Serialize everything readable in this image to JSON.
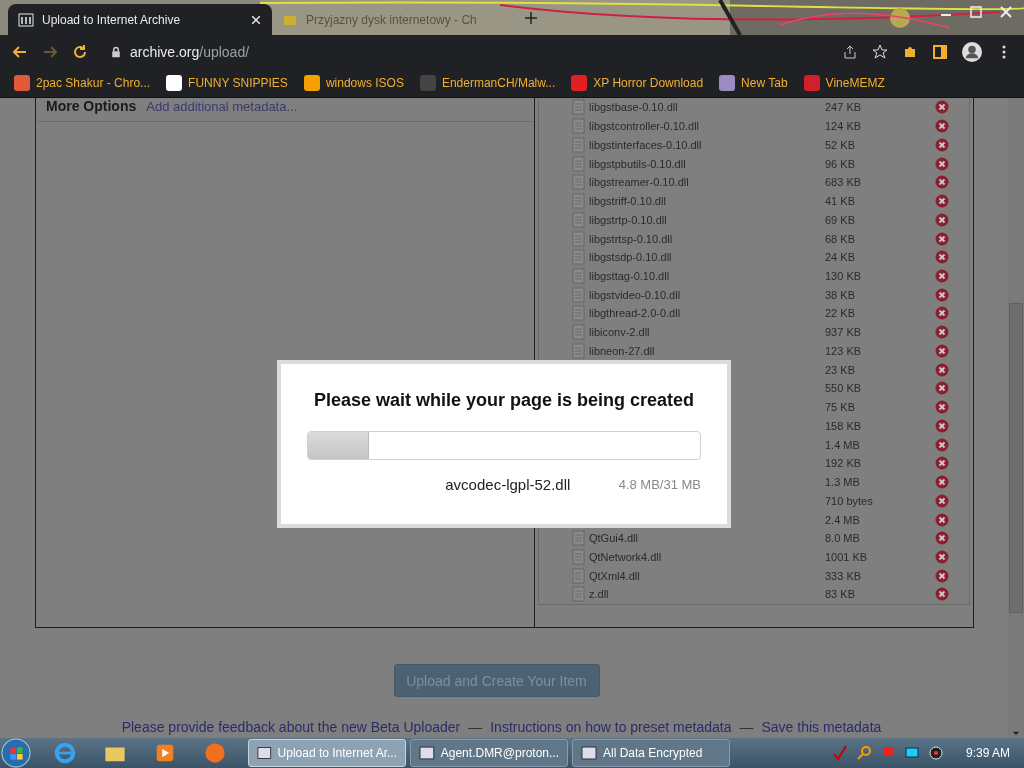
{
  "browser": {
    "tabs": [
      {
        "title": "Upload to Internet Archive",
        "selected": true
      },
      {
        "title": "Przyjazny dysk internetowy - Ch",
        "selected": false
      }
    ],
    "address": {
      "host": "archive.org",
      "path": "/upload/"
    },
    "bookmarks": [
      {
        "label": "2pac Shakur - Chro...",
        "color": "#e05a3a"
      },
      {
        "label": "FUNNY SNIPPIES",
        "color": "#ffffff"
      },
      {
        "label": "windows ISOS",
        "color": "#f5a000"
      },
      {
        "label": "EndermanCH/Malw...",
        "color": "#444444"
      },
      {
        "label": "XP Horror Download",
        "color": "#e02020"
      },
      {
        "label": "New Tab",
        "color": "#9a8cc0"
      },
      {
        "label": "VineMEMZ",
        "color": "#d0202a"
      }
    ]
  },
  "left_panel": {
    "heading": "More Options",
    "link": "Add additional metadata..."
  },
  "files": [
    {
      "name": "libgstbase-0.10.dll",
      "size": "247 KB"
    },
    {
      "name": "libgstcontroller-0.10.dll",
      "size": "124 KB"
    },
    {
      "name": "libgstinterfaces-0.10.dll",
      "size": "52 KB"
    },
    {
      "name": "libgstpbutils-0.10.dll",
      "size": "96 KB"
    },
    {
      "name": "libgstreamer-0.10.dll",
      "size": "683 KB"
    },
    {
      "name": "libgstriff-0.10.dll",
      "size": "41 KB"
    },
    {
      "name": "libgstrtp-0.10.dll",
      "size": "69 KB"
    },
    {
      "name": "libgstrtsp-0.10.dll",
      "size": "68 KB"
    },
    {
      "name": "libgstsdp-0.10.dll",
      "size": "24 KB"
    },
    {
      "name": "libgsttag-0.10.dll",
      "size": "130 KB"
    },
    {
      "name": "libgstvideo-0.10.dll",
      "size": "38 KB"
    },
    {
      "name": "libgthread-2.0-0.dll",
      "size": "22 KB"
    },
    {
      "name": "libiconv-2.dll",
      "size": "937 KB"
    },
    {
      "name": "libneon-27.dll",
      "size": "123 KB"
    },
    {
      "size": "23 KB"
    },
    {
      "size": "550 KB"
    },
    {
      "size": "75 KB"
    },
    {
      "size": "158 KB"
    },
    {
      "size": "1.4 MB"
    },
    {
      "size": "192 KB"
    },
    {
      "size": "1.3 MB"
    },
    {
      "size": "710 bytes"
    },
    {
      "size": "2.4 MB"
    },
    {
      "name": "QtGui4.dll",
      "size": "8.0 MB"
    },
    {
      "name": "QtNetwork4.dll",
      "size": "1001 KB"
    },
    {
      "name": "QtXml4.dll",
      "size": "333 KB"
    },
    {
      "name": "z.dll",
      "size": "83 KB"
    }
  ],
  "submit_button": "Upload and Create Your Item",
  "footer_links": [
    "Please provide feedback about the new Beta Uploader",
    "Instructions on how to preset metadata",
    "Save this metadata"
  ],
  "footer_separator": "—",
  "modal": {
    "title": "Please wait while your page is being created",
    "progress": {
      "level": 0.155
    },
    "file": "avcodec-lgpl-52.dll",
    "amount": "4.8 MB/31 MB"
  },
  "taskbar": {
    "tasks": [
      {
        "label": "Upload to Internet Ar...",
        "selected": true
      },
      {
        "label": "Agent.DMR@proton...",
        "selected": false
      },
      {
        "label": "All Data Encrypted",
        "selected": false
      }
    ],
    "clock": "9:39 AM"
  }
}
